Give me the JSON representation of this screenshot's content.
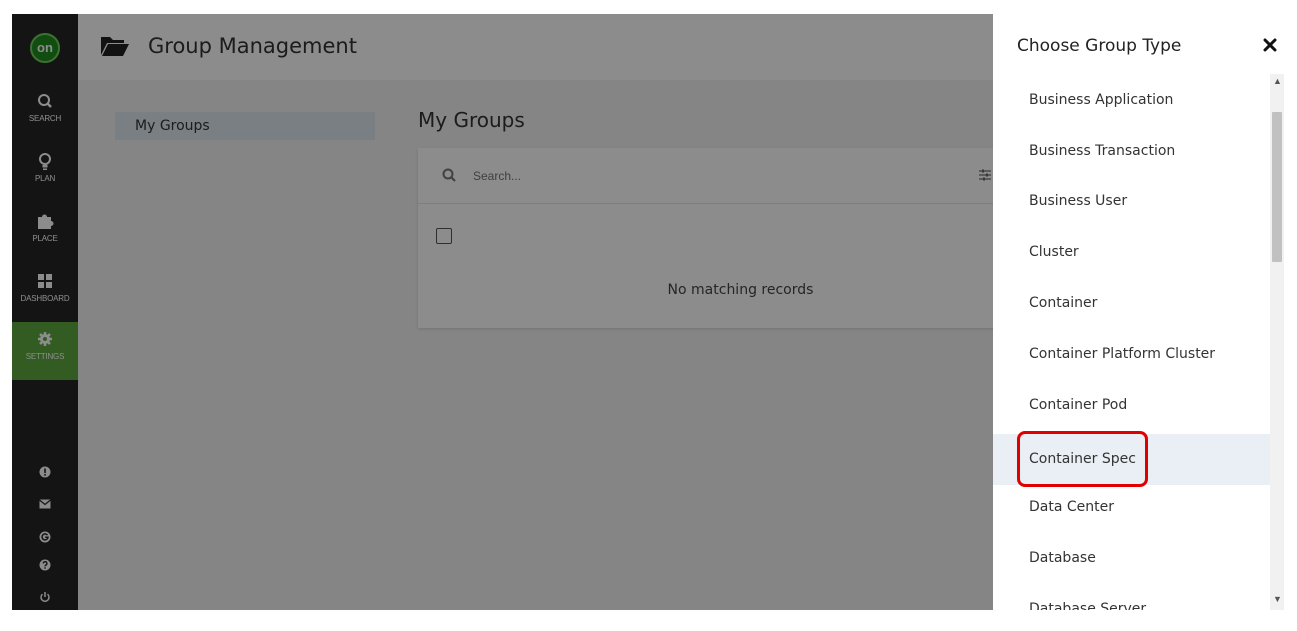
{
  "nav": {
    "logo": "on",
    "items": [
      {
        "label": "SEARCH",
        "icon": "search-icon"
      },
      {
        "label": "PLAN",
        "icon": "lightbulb-icon"
      },
      {
        "label": "PLACE",
        "icon": "puzzle-icon"
      },
      {
        "label": "DASHBOARD",
        "icon": "dashboard-icon"
      },
      {
        "label": "SETTINGS",
        "icon": "gear-icon"
      }
    ],
    "active_color": "#5ca83c",
    "bottom_icons": [
      "alert-icon",
      "mail-icon",
      "g-icon",
      "help-icon",
      "power-icon"
    ]
  },
  "header": {
    "title": "Group Management",
    "icon": "folder-open-icon"
  },
  "sidebar": {
    "tab": "My Groups"
  },
  "main": {
    "title": "My Groups",
    "search_placeholder": "Search...",
    "empty_text": "No matching records"
  },
  "panel": {
    "title": "Choose Group Type",
    "items": [
      "Business Application",
      "Business Transaction",
      "Business User",
      "Cluster",
      "Container",
      "Container Platform Cluster",
      "Container Pod",
      "Container Spec",
      "Data Center",
      "Database",
      "Database Server"
    ],
    "highlighted_item": "Container Spec",
    "highlight_color": "#e00000"
  }
}
